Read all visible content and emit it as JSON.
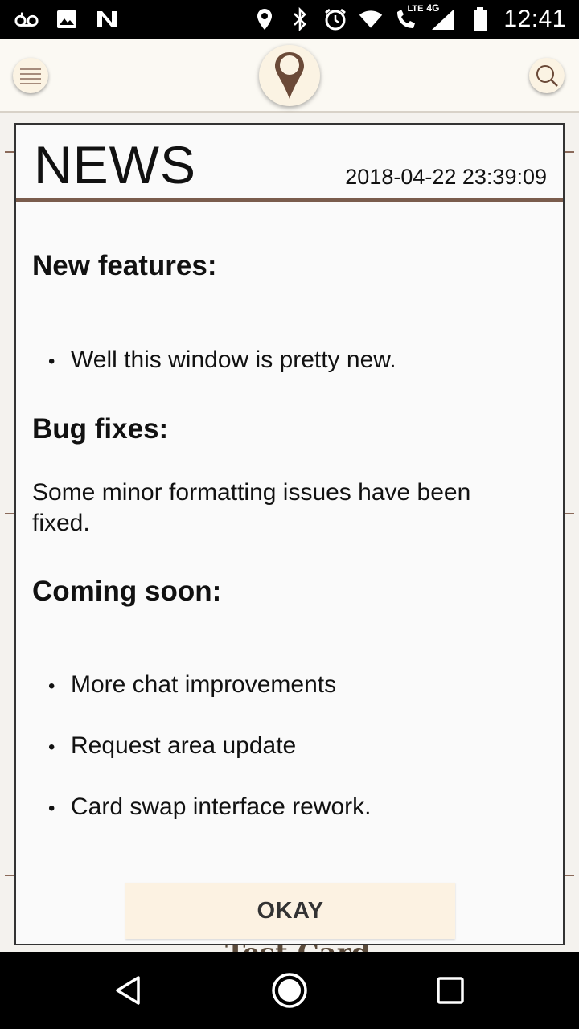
{
  "status_bar": {
    "time": "12:41",
    "left_icons": [
      "voicemail-icon",
      "image-icon",
      "n-icon"
    ],
    "right_icons": [
      "location-icon",
      "bluetooth-icon",
      "alarm-icon",
      "wifi-icon",
      "lte-call-icon",
      "signal-4g-icon",
      "battery-icon"
    ],
    "network_label": "4G",
    "lte_label": "LTE"
  },
  "topbar": {
    "menu_icon": "hamburger-menu-icon",
    "logo_icon": "map-pin-icon",
    "search_icon": "search-icon",
    "colors": {
      "button_bg": "#fbf3e3",
      "accent": "#7a5c4c"
    }
  },
  "background": {
    "peek_text": "Test Card"
  },
  "dialog": {
    "title": "NEWS",
    "date": "2018-04-22 23:39:09",
    "sections": {
      "new_features": {
        "title": "New features:",
        "items": [
          "Well this window is pretty new."
        ]
      },
      "bug_fixes": {
        "title": "Bug fixes:",
        "text": "Some minor formatting issues have been fixed."
      },
      "coming_soon": {
        "title": "Coming soon:",
        "items": [
          "More chat improvements",
          "Request area update",
          "Card swap interface rework."
        ]
      }
    },
    "okay_label": "OKAY"
  },
  "navbar": {
    "icons": [
      "back-icon",
      "home-icon",
      "recents-icon"
    ]
  }
}
